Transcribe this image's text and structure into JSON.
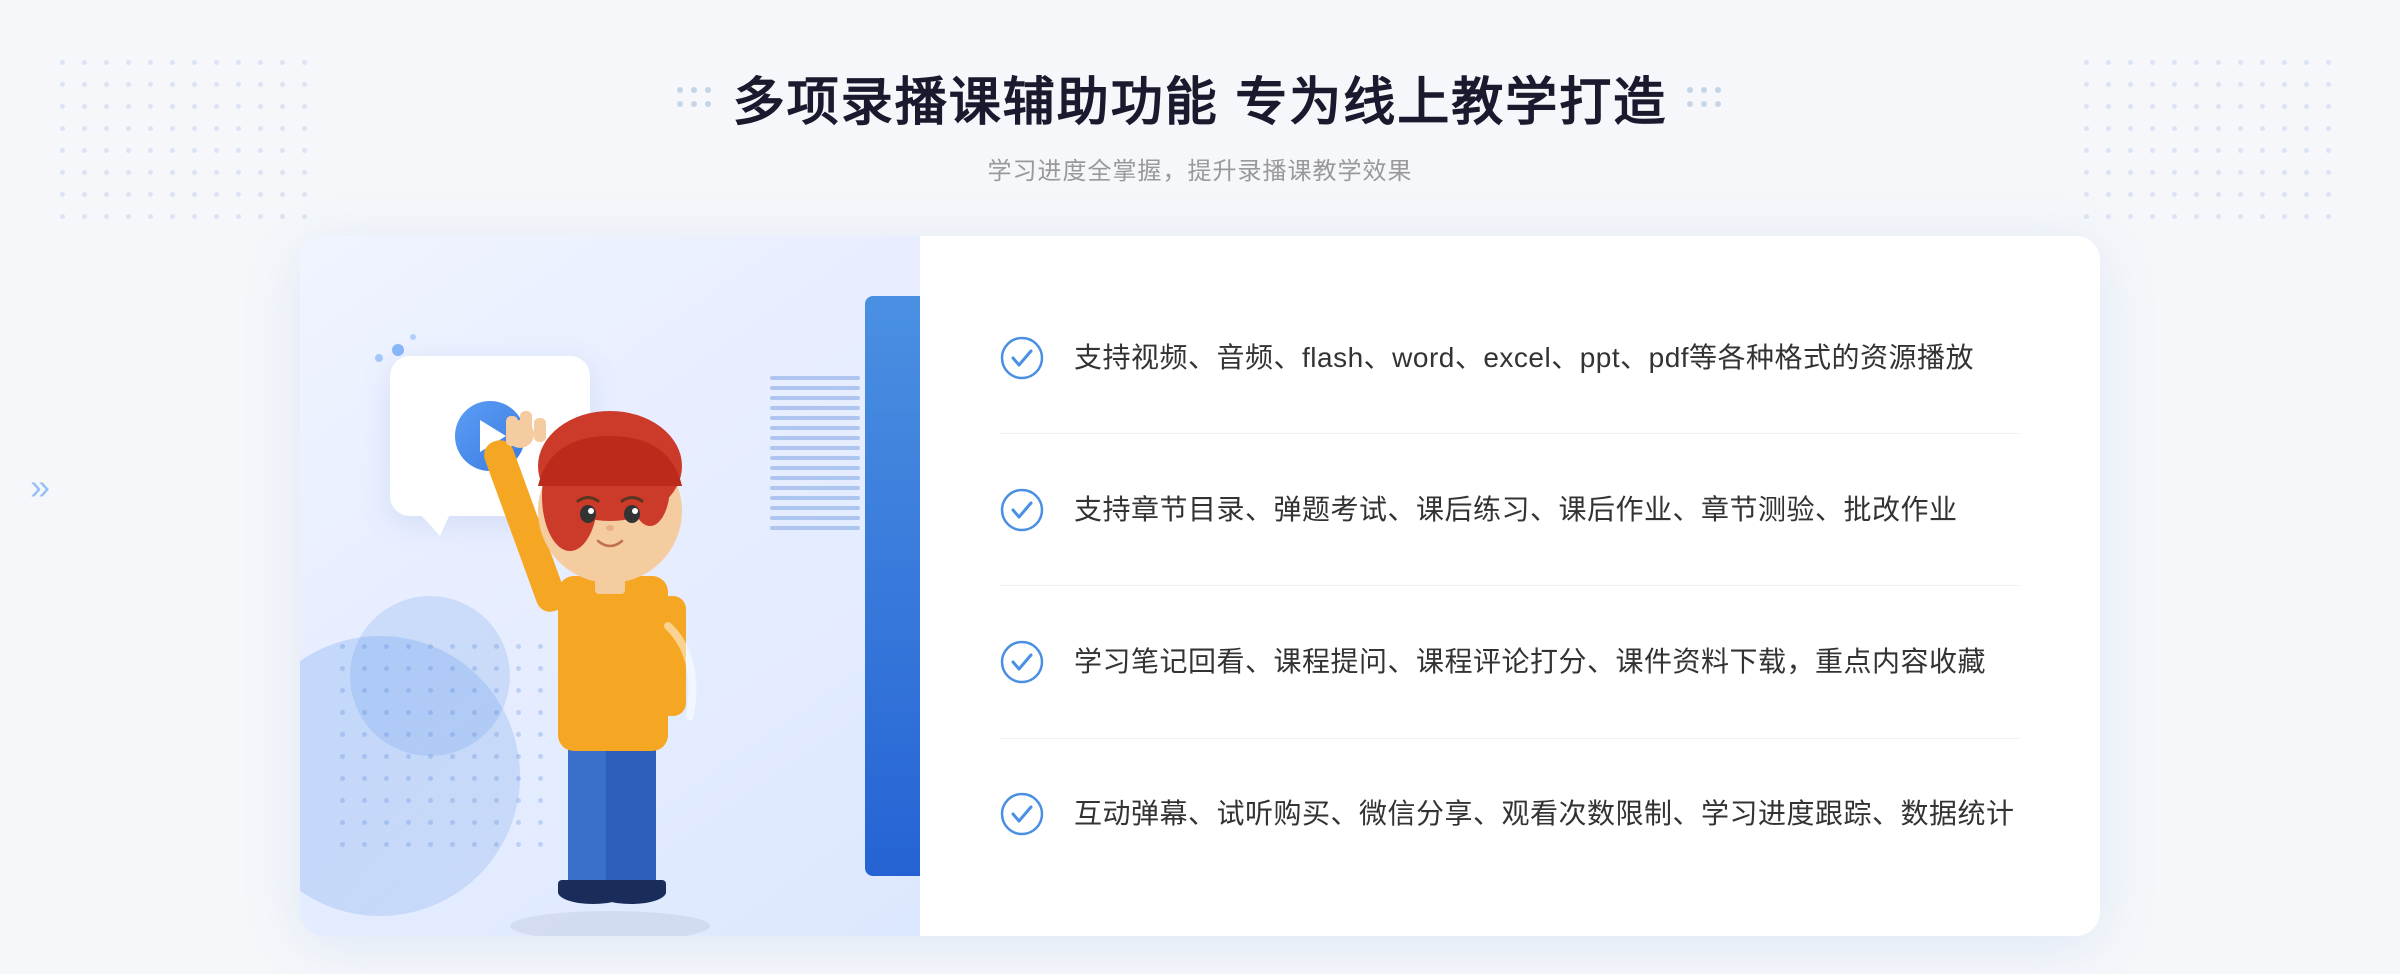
{
  "page": {
    "background_color": "#f5f7fa"
  },
  "header": {
    "title": "多项录播课辅助功能 专为线上教学打造",
    "subtitle": "学习进度全掌握，提升录播课教学效果",
    "decorative_dots_count": 6
  },
  "features": [
    {
      "id": 1,
      "text": "支持视频、音频、flash、word、excel、ppt、pdf等各种格式的资源播放",
      "icon": "check-circle"
    },
    {
      "id": 2,
      "text": "支持章节目录、弹题考试、课后练习、课后作业、章节测验、批改作业",
      "icon": "check-circle"
    },
    {
      "id": 3,
      "text": "学习笔记回看、课程提问、课程评论打分、课件资料下载，重点内容收藏",
      "icon": "check-circle"
    },
    {
      "id": 4,
      "text": "互动弹幕、试听购买、微信分享、观看次数限制、学习进度跟踪、数据统计",
      "icon": "check-circle"
    }
  ],
  "illustration": {
    "video_bubble_bg": "#ffffff",
    "blue_bar_color": "#3a7be0",
    "accent_color": "#5b9df5"
  },
  "colors": {
    "primary_blue": "#3a7be0",
    "light_blue": "#5b9df5",
    "icon_blue": "#4a90e2",
    "text_main": "#333333",
    "text_sub": "#999999",
    "divider": "#f0f0f0"
  }
}
